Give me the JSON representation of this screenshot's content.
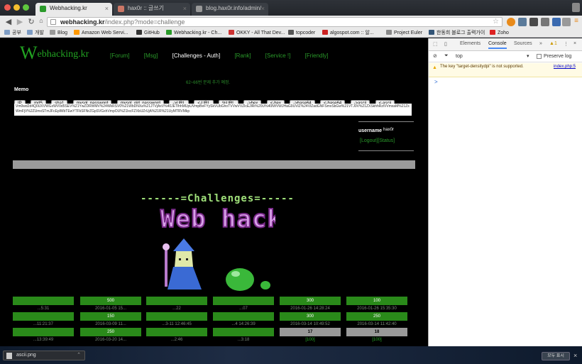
{
  "browser": {
    "tabs": [
      {
        "title": "Webhacking.kr",
        "active": true
      },
      {
        "title": "hax0r :: 글쓰기",
        "active": false
      },
      {
        "title": "blog.hax0r.info/admin/",
        "active": false
      }
    ],
    "url_domain": "webhacking.kr",
    "url_path": "/index.php?mode=challenge",
    "user_label": "—"
  },
  "bookmarks": [
    "공부",
    "개발",
    "Blog",
    "Amazon Web Servi...",
    "GitHub",
    "Webhacking.kr - Ch...",
    "OKKY - All That Dev...",
    "topcoder",
    "algospot.com :: 알...",
    "Project Euler",
    "한동희 블로그 출력가이",
    "Zoho"
  ],
  "site": {
    "logo_initial": "W",
    "logo_rest": "ebhacking.kr",
    "nav": [
      "[Forum]",
      "[Msg]",
      "[Challenges - Auth]",
      "[Rank]",
      "[Service !]",
      "[Friendly]"
    ],
    "notice": "62~66번 문제 추가 예정.",
    "memo_label": "Memo",
    "encode_buttons": [
      "IP",
      "md5",
      "sha1",
      "mysql_password",
      "mysql_old_password",
      "->URL",
      "<-URL",
      "%URL",
      "->hex",
      "<-hex",
      "->base64",
      "<-base64",
      "->ascii",
      "<-ascii"
    ],
    "memo_text": "Vm0wd2d4Q0UXVWGxWV0d5SEV%21YwZDRWMV%24WkRSV0%21WbDNXa%21JTVjAxV%40JETlhhMUpUVmpBeFYySkVUbGhoTVVwVVZlcEJlRi%20U%40lWVWJHaG9UVlZ%24VlZadGNFSmxSbGw%21VTJ0V%21ZXSkhhRzlVVmxaM%21ZsWmFjV%2ZUmxSTmJFcEplWbTEwYTFkSFNrZGpSVGxhVmpOU%21lxcFZXbUZrUjA%21R%21UyMTRVMkp",
    "username_label": "username",
    "username_value": "hax0r",
    "logout": "[Logout]",
    "status": "[Status]",
    "challenges_title": "------=Challenges=-----",
    "banner_text": "Web hack"
  },
  "challenge_grid": {
    "rows": [
      [
        {
          "t": "g",
          "v": ""
        },
        {
          "t": "g",
          "v": "500"
        },
        {
          "t": "g",
          "v": ""
        },
        {
          "t": "g",
          "v": ""
        },
        {
          "t": "g",
          "v": "300"
        },
        {
          "t": "g",
          "v": "100"
        }
      ],
      [
        {
          "t": "t",
          "v": "...5:31"
        },
        {
          "t": "t",
          "v": "2016-01-05 15..."
        },
        {
          "t": "t",
          "v": "...22"
        },
        {
          "t": "t",
          "v": "...07"
        },
        {
          "t": "t",
          "v": "2016-01-26 14:28:24"
        },
        {
          "t": "t",
          "v": "2016-01-26 15:35:30"
        }
      ],
      [
        {
          "t": "g",
          "v": ""
        },
        {
          "t": "g",
          "v": "150"
        },
        {
          "t": "g",
          "v": ""
        },
        {
          "t": "g",
          "v": ""
        },
        {
          "t": "g",
          "v": "300"
        },
        {
          "t": "g",
          "v": "250"
        }
      ],
      [
        {
          "t": "t",
          "v": "...11:21:37"
        },
        {
          "t": "t",
          "v": "2016-03-09 11..."
        },
        {
          "t": "t",
          "v": "...3-11 12:46:45"
        },
        {
          "t": "t",
          "v": "...4 14:26:39"
        },
        {
          "t": "t",
          "v": "2016-03-14 10:49:52"
        },
        {
          "t": "t",
          "v": "2016-03-14 11:42:40"
        }
      ],
      [
        {
          "t": "g",
          "v": ""
        },
        {
          "t": "g",
          "v": "250"
        },
        {
          "t": "g",
          "v": ""
        },
        {
          "t": "g",
          "v": ""
        },
        {
          "t": "gray",
          "v": "17"
        },
        {
          "t": "gray",
          "v": "18"
        }
      ],
      [
        {
          "t": "t",
          "v": "...13:39:49"
        },
        {
          "t": "t",
          "v": "2016-03-20 14..."
        },
        {
          "t": "t",
          "v": "...2:46"
        },
        {
          "t": "t",
          "v": "...3:18"
        },
        {
          "t": "lnk",
          "v": "[100]"
        },
        {
          "t": "lnk",
          "v": "[100]"
        }
      ]
    ]
  },
  "devtools": {
    "tabs": [
      "Elements",
      "Console",
      "Sources"
    ],
    "active_tab": "Console",
    "more": "»",
    "warn_count": "1",
    "context": "top",
    "preserve_log": "Preserve log",
    "warning_text": "The key \"target-densitydpi\" is not supported.",
    "warning_source": "index.php:5",
    "prompt": ">"
  },
  "downloads": {
    "file": "ascii.png",
    "show_all": "모두 표시"
  }
}
